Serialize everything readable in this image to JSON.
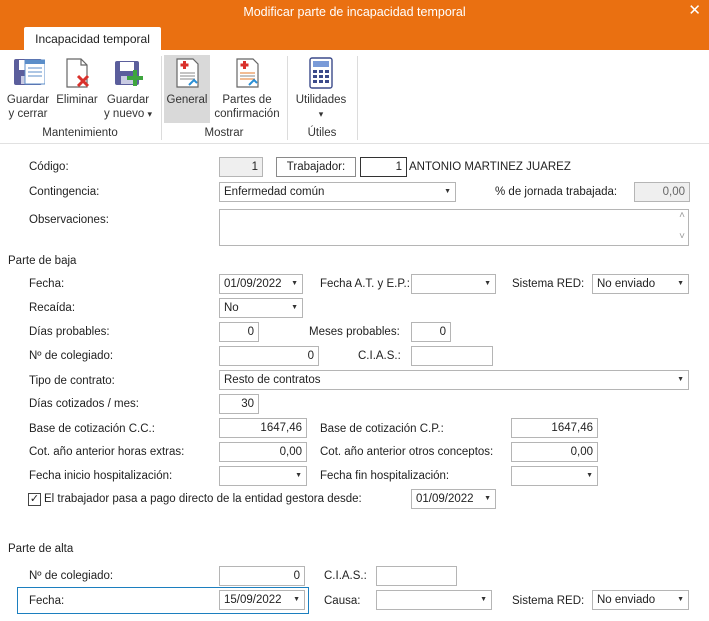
{
  "window": {
    "title": "Modificar parte de incapacidad temporal",
    "close_glyph": "✕"
  },
  "tab": {
    "label": "Incapacidad temporal"
  },
  "ribbon": {
    "groups": {
      "mantenimiento": "Mantenimiento",
      "mostrar": "Mostrar",
      "utiles": "Útiles"
    },
    "buttons": {
      "guardar_cerrar": {
        "line1": "Guardar",
        "line2": "y cerrar"
      },
      "eliminar": {
        "line1": "Eliminar"
      },
      "guardar_nuevo": {
        "line1": "Guardar",
        "line2": "y nuevo",
        "arrow": "▾"
      },
      "general": {
        "line1": "General"
      },
      "partes": {
        "line1": "Partes de",
        "line2": "confirmación"
      },
      "utilidades": {
        "line1": "Utilidades",
        "arrow": "▾"
      }
    }
  },
  "form": {
    "codigo_label": "Código:",
    "codigo_value": "1",
    "trabajador_button": "Trabajador:",
    "trabajador_id": "1",
    "trabajador_name": "ANTONIO MARTINEZ JUAREZ",
    "contingencia_label": "Contingencia:",
    "contingencia_value": "Enfermedad común",
    "jornada_label": "% de jornada trabajada:",
    "jornada_value": "0,00",
    "observaciones_label": "Observaciones:",
    "observaciones_value": "",
    "scroll_up": "˄",
    "scroll_down": "˅",
    "dropdown_arrow": "▼"
  },
  "baja": {
    "section": "Parte de baja",
    "fecha_label": "Fecha:",
    "fecha_value": "01/09/2022",
    "fecha_at_label": "Fecha A.T. y E.P.:",
    "fecha_at_value": "",
    "sistema_red_label": "Sistema RED:",
    "sistema_red_value": "No enviado",
    "recaida_label": "Recaída:",
    "recaida_value": "No",
    "dias_probables_label": "Días probables:",
    "dias_probables_value": "0",
    "meses_probables_label": "Meses probables:",
    "meses_probables_value": "0",
    "colegiado_label": "Nº de colegiado:",
    "colegiado_value": "0",
    "cias_label": "C.I.A.S.:",
    "cias_value": "",
    "tipo_contrato_label": "Tipo de contrato:",
    "tipo_contrato_value": "Resto de contratos",
    "dias_cotizados_label": "Días cotizados / mes:",
    "dias_cotizados_value": "30",
    "base_cc_label": "Base de cotización C.C.:",
    "base_cc_value": "1647,46",
    "base_cp_label": "Base de cotización C.P.:",
    "base_cp_value": "1647,46",
    "horas_extras_label": "Cot. año anterior horas extras:",
    "horas_extras_value": "0,00",
    "otros_conceptos_label": "Cot. año anterior otros conceptos:",
    "otros_conceptos_value": "0,00",
    "hosp_inicio_label": "Fecha inicio hospitalización:",
    "hosp_inicio_value": "",
    "hosp_fin_label": "Fecha fin hospitalización:",
    "hosp_fin_value": "",
    "pago_directo_check": "✓",
    "pago_directo_label": "El trabajador pasa a pago directo de la entidad gestora desde:",
    "pago_directo_fecha": "01/09/2022"
  },
  "alta": {
    "section": "Parte de alta",
    "colegiado_label": "Nº de colegiado:",
    "colegiado_value": "0",
    "cias_label": "C.I.A.S.:",
    "cias_value": "",
    "fecha_label": "Fecha:",
    "fecha_value": "15/09/2022",
    "causa_label": "Causa:",
    "causa_value": "",
    "sistema_red_label": "Sistema RED:",
    "sistema_red_value": "No enviado"
  },
  "colors": {
    "accent": "#ea7011",
    "focus": "#1c7fbf",
    "selected": "#d9d9d9"
  }
}
